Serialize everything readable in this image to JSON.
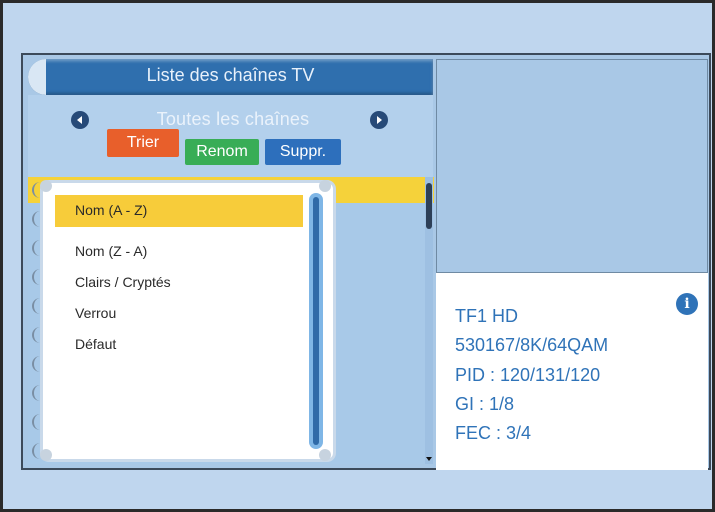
{
  "header": {
    "title": "Liste des chaînes TV"
  },
  "group": {
    "label": "Toutes les chaînes"
  },
  "buttons": {
    "trier": "Trier",
    "renom": "Renom",
    "suppr": "Suppr."
  },
  "sort_menu": {
    "items": [
      "Nom (A - Z)",
      "Nom (Z - A)",
      "Clairs / Cryptés",
      "Verrou",
      "Défaut"
    ],
    "selected_index": 0
  },
  "channel_info": {
    "name": "TF1 HD",
    "frequency": "530167/8K/64QAM",
    "pid": "PID : 120/131/120",
    "gi": "GI : 1/8",
    "fec": "FEC : 3/4"
  },
  "colors": {
    "accent": "#2f73b8",
    "trier": "#e85f2b",
    "renom": "#38ad56",
    "suppr": "#2d6fbc",
    "highlight": "#f7cc3a"
  },
  "icons": {
    "nav_left": "arrow-left-icon",
    "nav_right": "arrow-right-icon",
    "info": "info-icon",
    "scroll_down": "scroll-down-icon"
  }
}
